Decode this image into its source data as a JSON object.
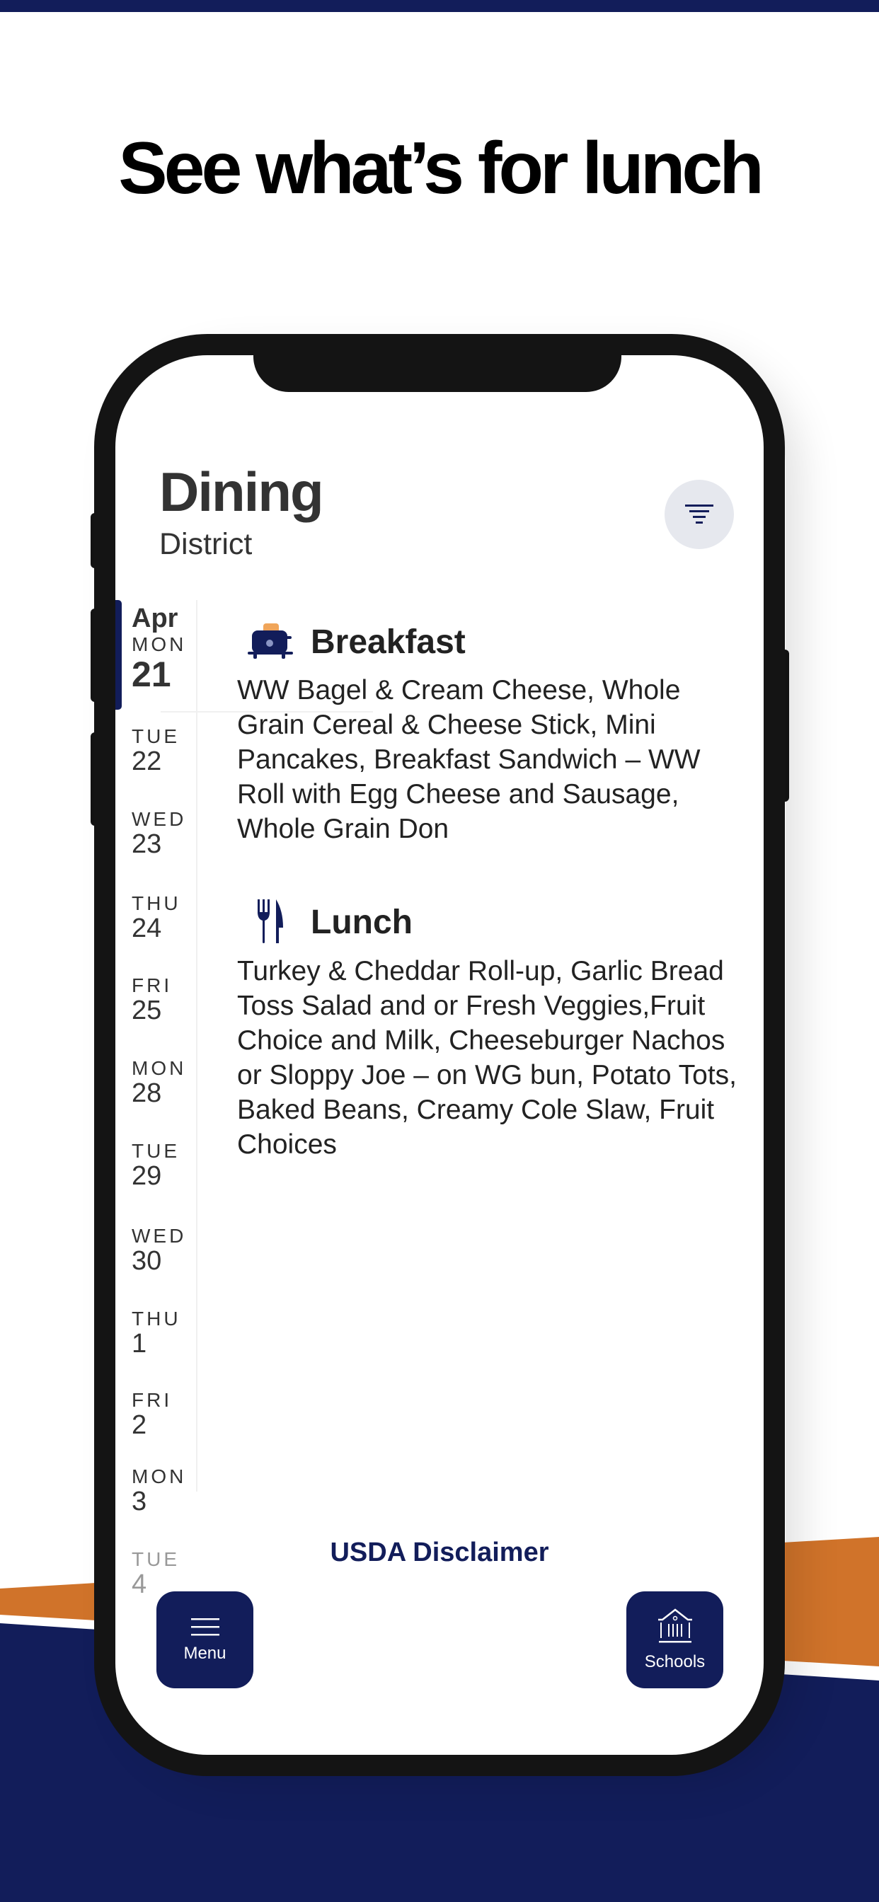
{
  "promo": {
    "headline": "See what’s for lunch",
    "colors": {
      "navy": "#121d5a",
      "orange": "#d0732a",
      "white": "#ffffff"
    }
  },
  "app": {
    "title": "Dining",
    "subtitle": "District",
    "filter_icon": "filter-icon"
  },
  "dates": {
    "selected": {
      "month": "Apr",
      "dow": "MON",
      "day": "21"
    },
    "items": [
      {
        "dow": "TUE",
        "day": "22"
      },
      {
        "dow": "WED",
        "day": "23"
      },
      {
        "dow": "THU",
        "day": "24"
      },
      {
        "dow": "FRI",
        "day": "25"
      },
      {
        "dow": "MON",
        "day": "28"
      },
      {
        "dow": "TUE",
        "day": "29"
      },
      {
        "dow": "WED",
        "day": "30"
      },
      {
        "dow": "THU",
        "day": "1"
      },
      {
        "dow": "FRI",
        "day": "2"
      },
      {
        "dow": "MON",
        "day": "3"
      },
      {
        "dow": "TUE",
        "day": "4"
      }
    ]
  },
  "meals": [
    {
      "name": "Breakfast",
      "icon": "toaster-icon",
      "items": "WW Bagel & Cream Cheese, Whole Grain Cereal & Cheese Stick, Mini Pancakes, Breakfast Sandwich – WW Roll with Egg Cheese and Sausage, Whole Grain Don"
    },
    {
      "name": "Lunch",
      "icon": "fork-knife-icon",
      "items": "Turkey & Cheddar Roll-up, Garlic Bread Toss Salad and or Fresh Veggies,Fruit Choice and Milk, Cheeseburger Nachos or Sloppy Joe – on WG bun, Potato Tots, Baked Beans, Creamy Cole Slaw, Fruit Choices"
    }
  ],
  "footer": {
    "disclaimer_link": "USDA Disclaimer",
    "menu_button": {
      "label": "Menu",
      "icon": "hamburger-icon"
    },
    "schools_button": {
      "label": "Schools",
      "icon": "school-building-icon"
    }
  }
}
